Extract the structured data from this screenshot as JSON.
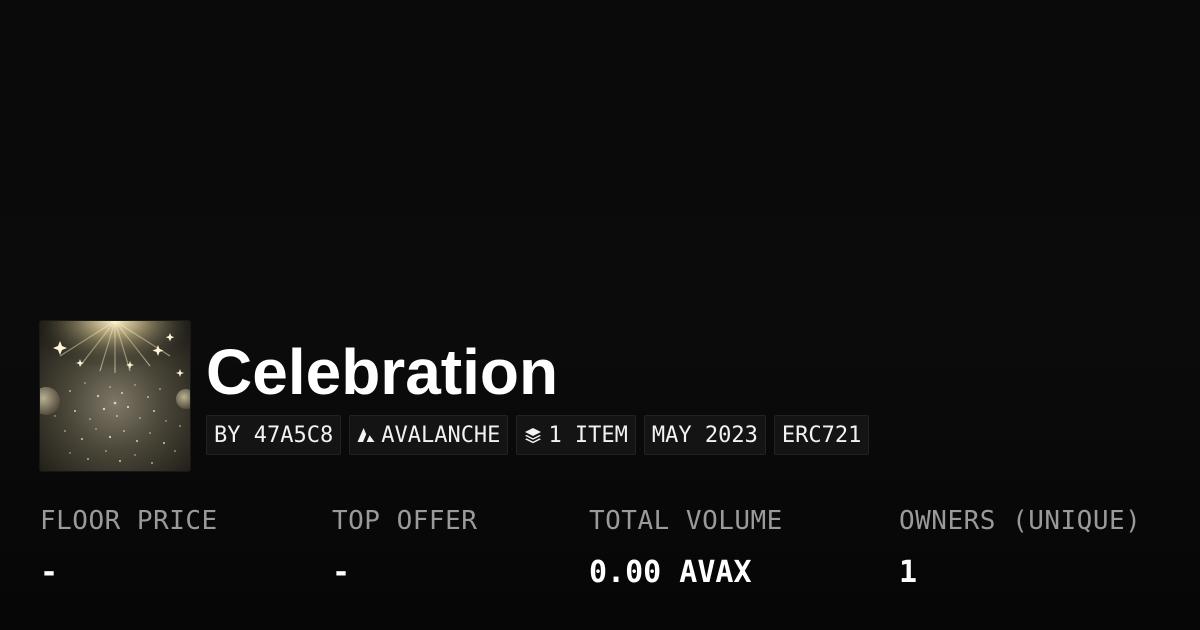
{
  "collection": {
    "title": "Celebration",
    "thumbnail_icon": "celebration-sparkle-image"
  },
  "tags": {
    "creator": "BY 47A5C8",
    "chain": "AVALANCHE",
    "chain_icon": "avalanche-logo-icon",
    "items": "1 ITEM",
    "items_icon": "layers-icon",
    "date": "MAY 2023",
    "standard": "ERC721"
  },
  "stats": {
    "floor_price": {
      "label": "FLOOR PRICE",
      "value": "-"
    },
    "top_offer": {
      "label": "TOP OFFER",
      "value": "-"
    },
    "total_volume": {
      "label": "TOTAL VOLUME",
      "value": "0.00 AVAX"
    },
    "owners": {
      "label": "OWNERS (UNIQUE)",
      "value": "1"
    }
  },
  "colors": {
    "background": "#0b0b0b",
    "text": "#ffffff",
    "muted_label": "#9a9a9a",
    "chip_bg": "#141414",
    "chip_border": "#222222"
  }
}
